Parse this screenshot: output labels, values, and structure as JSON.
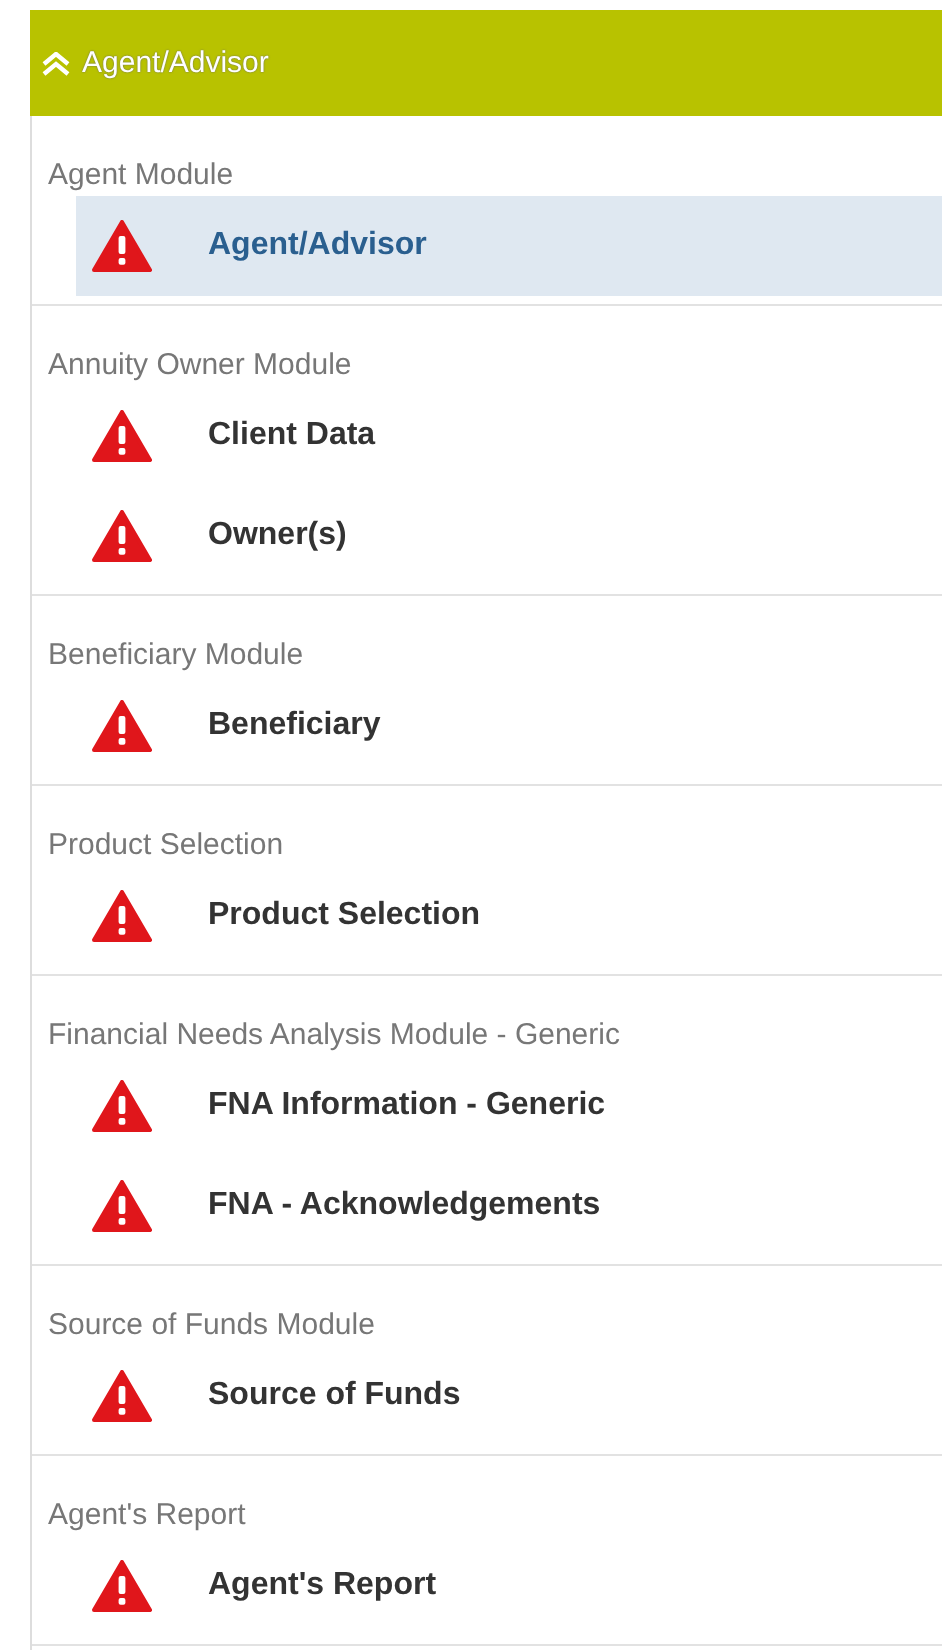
{
  "header": {
    "title": "Agent/Advisor",
    "expanded": true
  },
  "sections": [
    {
      "label": "Agent Module",
      "items": [
        {
          "label": "Agent/Advisor",
          "selected": true
        }
      ]
    },
    {
      "label": "Annuity Owner Module",
      "items": [
        {
          "label": "Client Data",
          "selected": false
        },
        {
          "label": "Owner(s)",
          "selected": false
        }
      ]
    },
    {
      "label": "Beneficiary Module",
      "items": [
        {
          "label": "Beneficiary",
          "selected": false
        }
      ]
    },
    {
      "label": "Product Selection",
      "items": [
        {
          "label": "Product Selection",
          "selected": false
        }
      ]
    },
    {
      "label": "Financial Needs Analysis Module - Generic",
      "items": [
        {
          "label": "FNA Information - Generic",
          "selected": false
        },
        {
          "label": "FNA - Acknowledgements",
          "selected": false
        }
      ]
    },
    {
      "label": "Source of Funds Module",
      "items": [
        {
          "label": "Source of Funds",
          "selected": false
        }
      ]
    },
    {
      "label": "Agent's Report",
      "items": [
        {
          "label": "Agent's Report",
          "selected": false
        }
      ]
    }
  ]
}
